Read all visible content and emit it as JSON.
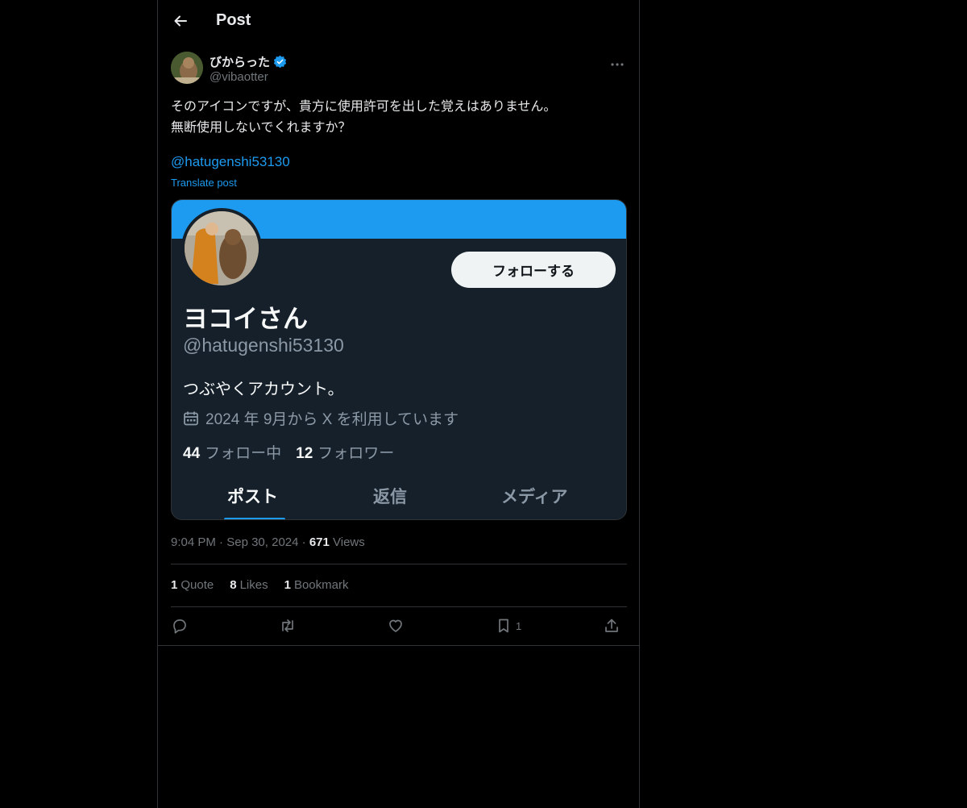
{
  "header": {
    "title": "Post"
  },
  "post": {
    "author_name": "びからった",
    "author_handle": "@vibaotter",
    "text_line1": "そのアイコンですが、貴方に使用許可を出した覚えはありません。",
    "text_line2": "無断使用しないでくれますか？",
    "mention": "@hatugenshi53130",
    "translate": "Translate post",
    "time": "9:04 PM",
    "date": "Sep 30, 2024",
    "views_count": "671",
    "views_label": "Views",
    "quotes_count": "1",
    "quotes_label": "Quote",
    "likes_count": "8",
    "likes_label": "Likes",
    "bookmarks_count": "1",
    "bookmarks_label": "Bookmark",
    "bookmark_action_count": "1"
  },
  "card": {
    "follow_button": "フォローする",
    "name": "ヨコイさん",
    "handle": "@hatugenshi53130",
    "bio": "つぶやくアカウント。",
    "joined": "2024 年 9月から X を利用しています",
    "following_count": "44",
    "following_label": "フォロー中",
    "followers_count": "12",
    "followers_label": "フォロワー",
    "tabs": [
      "ポスト",
      "返信",
      "メディア"
    ]
  },
  "colors": {
    "accent": "#1d9bf0",
    "background": "#000000",
    "card_bg": "#15202b"
  },
  "icons": [
    "back-arrow-icon",
    "verified-badge-icon",
    "more-icon",
    "calendar-icon",
    "reply-icon",
    "repost-icon",
    "like-icon",
    "bookmark-icon",
    "share-icon"
  ]
}
